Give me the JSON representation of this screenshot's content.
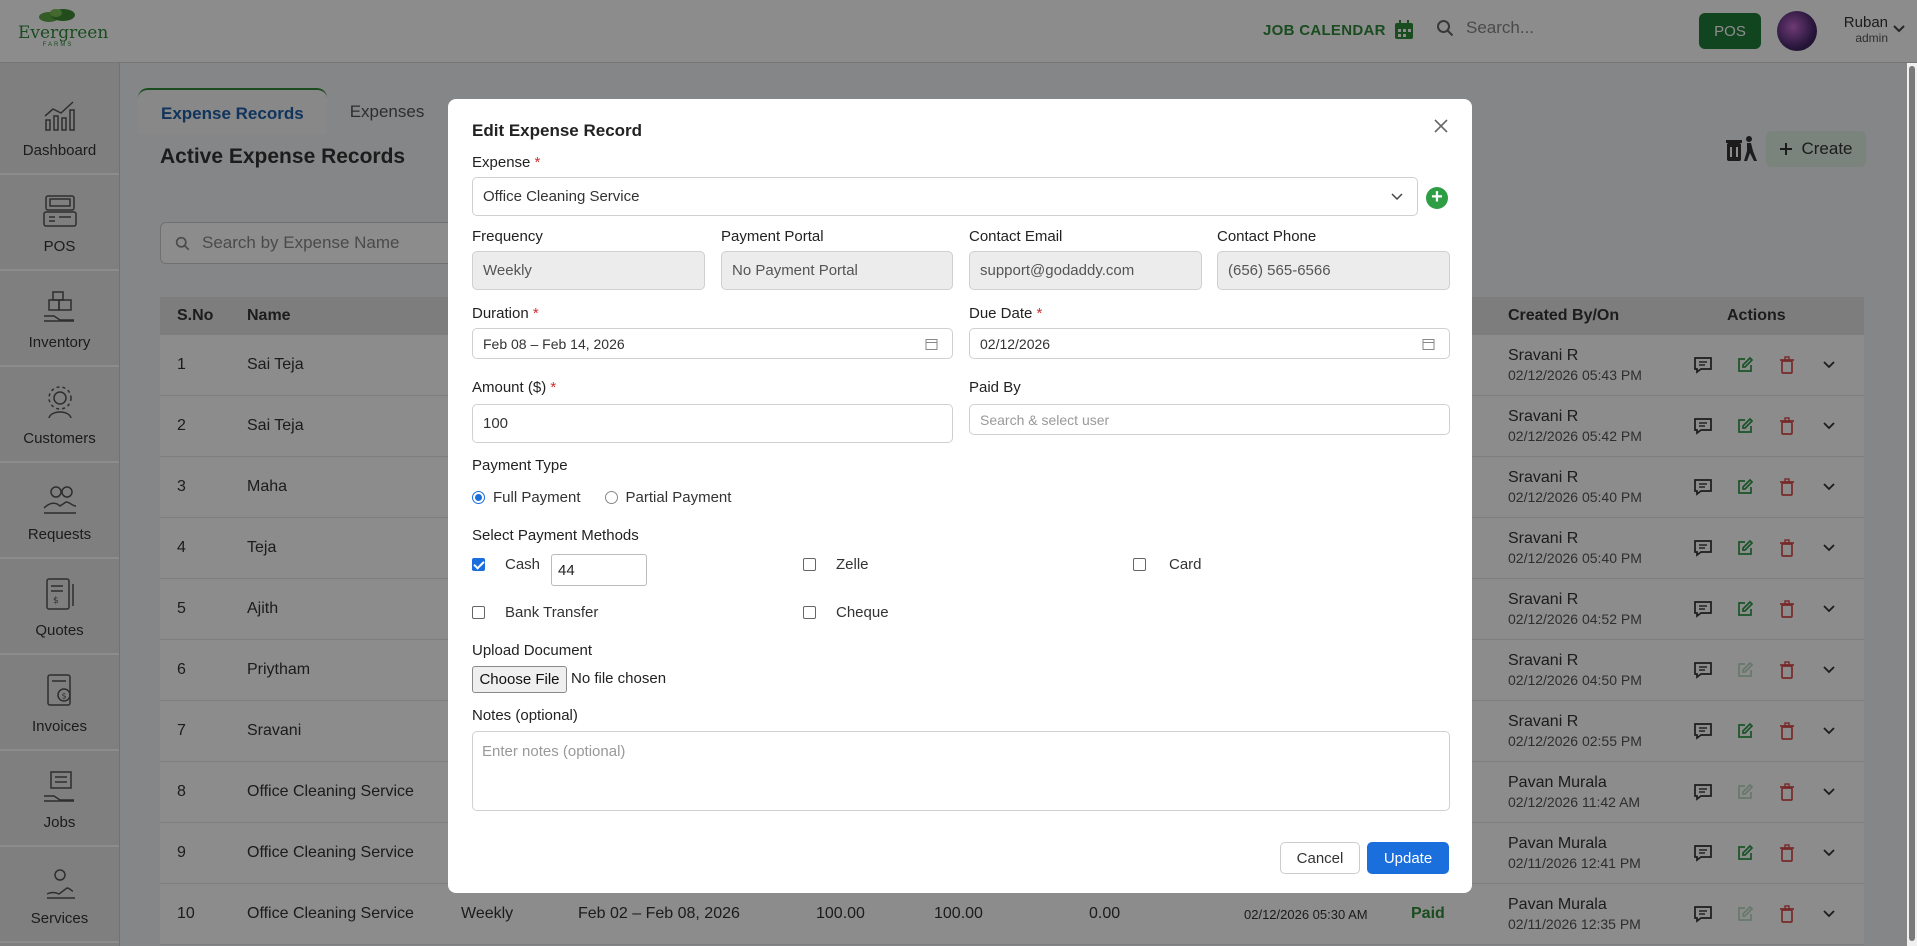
{
  "header": {
    "logo_text": "Evergreen",
    "logo_sub": "FARMS",
    "job_calendar": "JOB CALENDAR",
    "search_placeholder": "Search...",
    "pos_button": "POS",
    "user_name": "Ruban",
    "user_role": "admin"
  },
  "sidebar": {
    "items": [
      {
        "label": "Dashboard",
        "icon": "chart-icon"
      },
      {
        "label": "POS",
        "icon": "register-icon"
      },
      {
        "label": "Inventory",
        "icon": "inventory-icon"
      },
      {
        "label": "Customers",
        "icon": "customers-icon"
      },
      {
        "label": "Requests",
        "icon": "requests-icon"
      },
      {
        "label": "Quotes",
        "icon": "quotes-icon"
      },
      {
        "label": "Invoices",
        "icon": "invoices-icon"
      },
      {
        "label": "Jobs",
        "icon": "jobs-icon"
      },
      {
        "label": "Services",
        "icon": "services-icon"
      }
    ]
  },
  "main": {
    "tabs": [
      "Expense Records",
      "Expenses"
    ],
    "title": "Active Expense Records",
    "search_placeholder": "Search by Expense Name",
    "create_label": "Create",
    "columns": {
      "sno": "S.No",
      "name": "Name",
      "created": "Created By/On",
      "actions": "Actions"
    },
    "rows": [
      {
        "sno": "1",
        "name": "Sai Teja",
        "created_by": "Sravani R",
        "created_on": "02/12/2026 05:43 PM",
        "edit_enabled": true
      },
      {
        "sno": "2",
        "name": "Sai Teja",
        "created_by": "Sravani R",
        "created_on": "02/12/2026 05:42 PM",
        "edit_enabled": true
      },
      {
        "sno": "3",
        "name": "Maha",
        "created_by": "Sravani R",
        "created_on": "02/12/2026 05:40 PM",
        "edit_enabled": true
      },
      {
        "sno": "4",
        "name": "Teja",
        "created_by": "Sravani R",
        "created_on": "02/12/2026 05:40 PM",
        "edit_enabled": true
      },
      {
        "sno": "5",
        "name": "Ajith",
        "created_by": "Sravani R",
        "created_on": "02/12/2026 04:52 PM",
        "edit_enabled": true
      },
      {
        "sno": "6",
        "name": "Priytham",
        "created_by": "Sravani R",
        "created_on": "02/12/2026 04:50 PM",
        "edit_enabled": false
      },
      {
        "sno": "7",
        "name": "Sravani",
        "created_by": "Sravani R",
        "created_on": "02/12/2026 02:55 PM",
        "edit_enabled": true
      },
      {
        "sno": "8",
        "name": "Office Cleaning Service",
        "created_by": "Pavan Murala",
        "created_on": "02/12/2026 11:42 AM",
        "edit_enabled": false
      },
      {
        "sno": "9",
        "name": "Office Cleaning Service",
        "created_by": "Pavan Murala",
        "created_on": "02/11/2026 12:41 PM",
        "edit_enabled": true
      },
      {
        "sno": "10",
        "name": "Office Cleaning Service",
        "frequency": "Weekly",
        "duration": "Feb 02 – Feb 08, 2026",
        "amount": "100.00",
        "paid": "100.00",
        "balance": "0.00",
        "due": "02/12/2026 05:30 AM",
        "status": "Paid",
        "created_by": "Pavan Murala",
        "created_on": "02/11/2026 12:35 PM",
        "edit_enabled": false
      }
    ]
  },
  "modal": {
    "title": "Edit Expense Record",
    "expense_label": "Expense",
    "expense_value": "Office Cleaning Service",
    "frequency_label": "Frequency",
    "frequency_value": "Weekly",
    "portal_label": "Payment Portal",
    "portal_value": "No Payment Portal",
    "email_label": "Contact Email",
    "email_value": "support@godaddy.com",
    "phone_label": "Contact Phone",
    "phone_value": "(656) 565-6566",
    "duration_label": "Duration",
    "duration_value": "Feb 08 – Feb 14, 2026",
    "due_label": "Due Date",
    "due_value": "02/12/2026",
    "amount_label": "Amount ($)",
    "amount_value": "100",
    "paidby_label": "Paid By",
    "paidby_placeholder": "Search & select user",
    "payment_type_label": "Payment Type",
    "full_payment": "Full Payment",
    "partial_payment": "Partial Payment",
    "methods_label": "Select Payment Methods",
    "cash": "Cash",
    "cash_amount": "44",
    "zelle": "Zelle",
    "card": "Card",
    "bank": "Bank Transfer",
    "cheque": "Cheque",
    "upload_label": "Upload Document",
    "choose_file": "Choose File",
    "no_file": "No file chosen",
    "notes_label": "Notes (optional)",
    "notes_placeholder": "Enter notes (optional)",
    "cancel": "Cancel",
    "update": "Update",
    "required_mark": "*"
  },
  "colors": {
    "brand_green": "#2f8a3a",
    "primary_blue": "#1a6fdd",
    "danger": "#d32f2f"
  }
}
